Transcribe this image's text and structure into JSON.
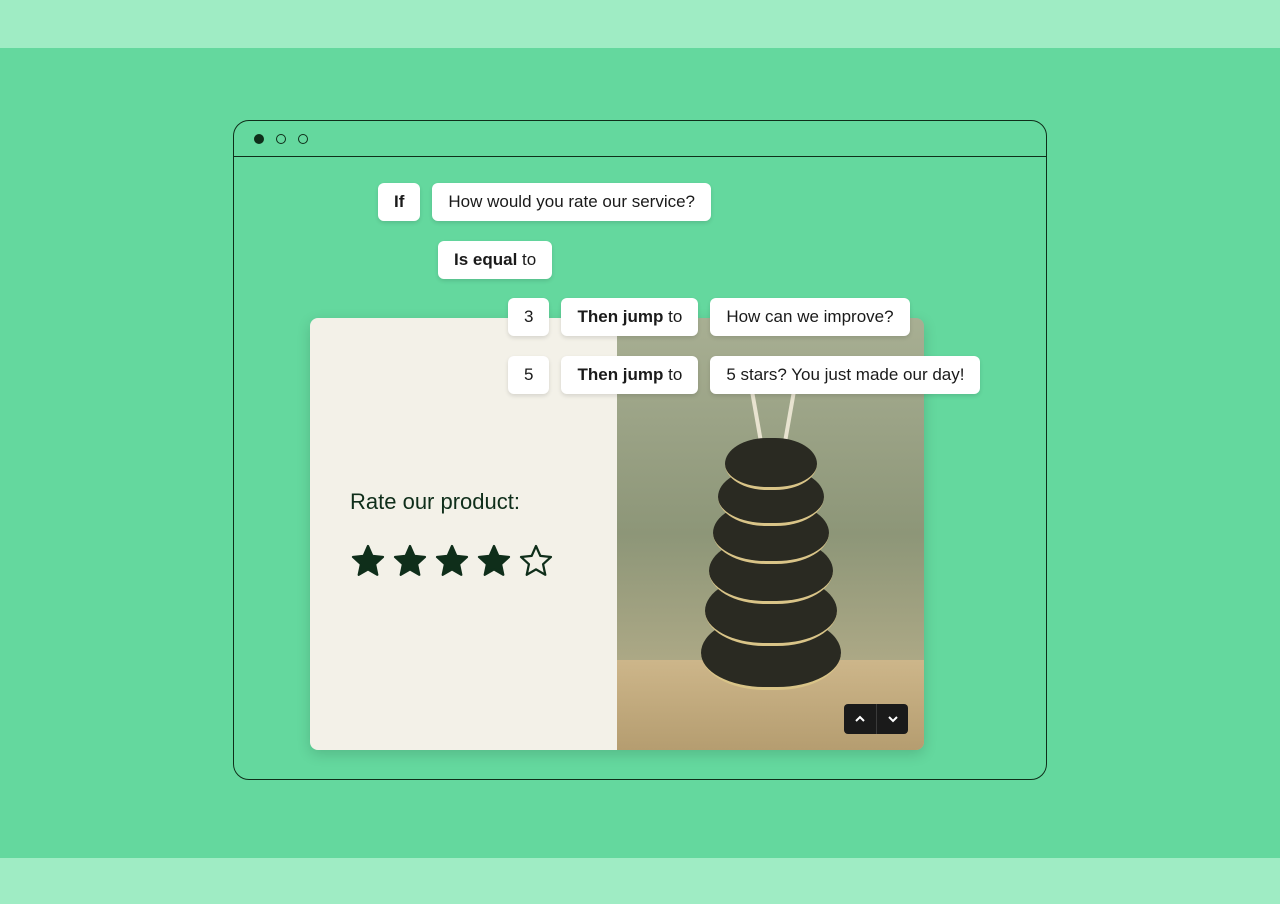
{
  "logic": {
    "if_label": "If",
    "question": "How would you rate our service?",
    "operator_bold": "Is equal",
    "operator_rest": " to",
    "rules": [
      {
        "value": "3",
        "action_bold": "Then jump",
        "action_rest": " to",
        "target": "How can we improve?"
      },
      {
        "value": "5",
        "action_bold": "Then jump",
        "action_rest": " to",
        "target": "5 stars? You just made our day!"
      }
    ]
  },
  "form": {
    "prompt": "Rate our product:",
    "rating": 4,
    "max_rating": 5
  },
  "colors": {
    "bg_light": "#9fecc4",
    "bg_dark": "#64d89e",
    "ink": "#0f2e1a",
    "card_left": "#f3f1e8"
  },
  "icons": {
    "chevron_up": "chevron-up-icon",
    "chevron_down": "chevron-down-icon",
    "star_filled": "star-filled-icon",
    "star_outline": "star-outline-icon",
    "window_dot": "window-control-icon"
  }
}
